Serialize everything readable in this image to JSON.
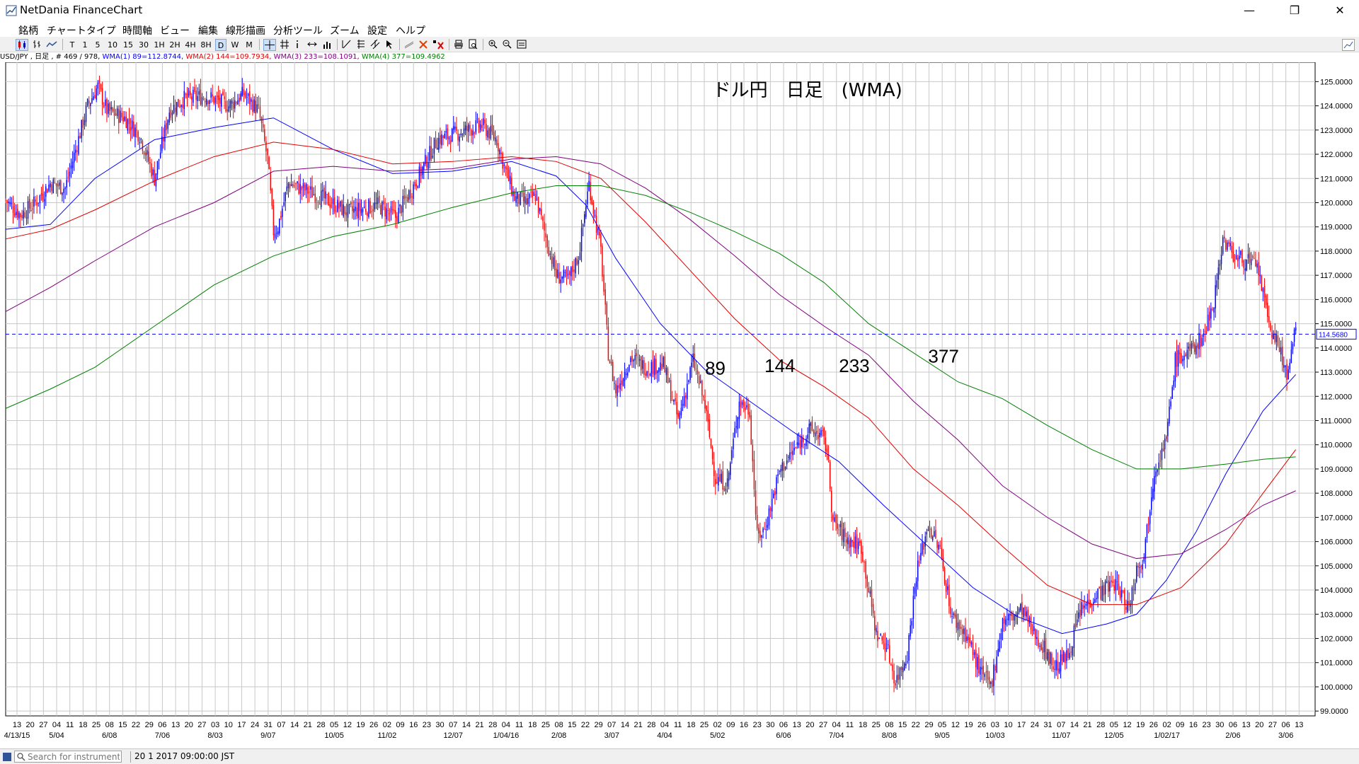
{
  "window": {
    "title": "NetDania FinanceChart",
    "minimize_glyph": "—",
    "restore_glyph": "❐",
    "close_glyph": "✕"
  },
  "menu": [
    "銘柄",
    "チャートタイプ",
    "時間軸",
    "ビュー",
    "編集",
    "線形描画",
    "分析ツール",
    "ズーム",
    "設定",
    "ヘルプ"
  ],
  "toolbar": {
    "timeframes": [
      "T",
      "1",
      "5",
      "10",
      "15",
      "30",
      "1H",
      "2H",
      "4H",
      "8H",
      "D",
      "W",
      "M"
    ],
    "active_timeframe": "D",
    "tools": [
      "crosshair-icon",
      "grid-icon",
      "info-icon",
      "arrows-icon",
      "volume-icon",
      "line-tool-icon",
      "fib-icon",
      "parallel-icon",
      "cursor-icon",
      "trendline-icon",
      "delete-icon",
      "clear-icon",
      "print-icon",
      "print-preview-icon",
      "zoom-in-icon",
      "zoom-out-icon",
      "zoom-fit-icon"
    ]
  },
  "legend": {
    "symbol": "USD/JPY , 日足 , # 469 / 978,",
    "wma1": "WMA(1) 89=112.8744,",
    "wma2": "WMA(2) 144=109.7934,",
    "wma3": "WMA(3) 233=108.1091,",
    "wma4": "WMA(4) 377=109.4962"
  },
  "colors": {
    "up": "#0000ff",
    "down": "#ff0000",
    "wma89": "#0000ff",
    "wma144": "#e00000",
    "wma233": "#800080",
    "wma377": "#008000",
    "grid": "#c8c8c8",
    "current_line": "#0000ff"
  },
  "status": {
    "search_placeholder": "Search for instrument",
    "time": "20 1 2017 09:00:00 JST"
  },
  "chart_data": {
    "type": "candlestick",
    "symbol": "USD/JPY",
    "title": "ドル円　日足　(WMA)",
    "current_price": "114.5680",
    "ylim": [
      98.8,
      125.8
    ],
    "y_ticks": [
      "125.0000",
      "124.0000",
      "123.0000",
      "122.0000",
      "121.0000",
      "120.0000",
      "119.0000",
      "118.0000",
      "117.0000",
      "116.0000",
      "115.0000",
      "114.0000",
      "113.0000",
      "112.0000",
      "111.0000",
      "110.0000",
      "109.0000",
      "108.0000",
      "107.0000",
      "106.0000",
      "105.0000",
      "104.0000",
      "103.0000",
      "102.0000",
      "101.0000",
      "100.0000",
      "99.0000"
    ],
    "x_ticks": [
      "13",
      "20",
      "27",
      "04",
      "11",
      "18",
      "25",
      "08",
      "15",
      "22",
      "29",
      "06",
      "13",
      "20",
      "27",
      "03",
      "10",
      "17",
      "24",
      "31",
      "07",
      "14",
      "21",
      "28",
      "05",
      "12",
      "19",
      "26",
      "02",
      "09",
      "16",
      "23",
      "30",
      "07",
      "14",
      "21",
      "28",
      "04",
      "11",
      "18",
      "25",
      "08",
      "15",
      "22",
      "29",
      "07",
      "14",
      "21",
      "28",
      "04",
      "11",
      "18",
      "25",
      "02",
      "09",
      "16",
      "23",
      "30",
      "06",
      "13",
      "20",
      "27",
      "04",
      "11",
      "18",
      "25",
      "08",
      "15",
      "22",
      "29",
      "05",
      "12",
      "19",
      "26",
      "03",
      "10",
      "17",
      "24",
      "31",
      "07",
      "14",
      "21",
      "28",
      "05",
      "12",
      "19",
      "26",
      "02",
      "09",
      "16",
      "23",
      "30",
      "06",
      "13",
      "20",
      "27",
      "06",
      "13"
    ],
    "x_month_labels": [
      {
        "label": "4/13/15",
        "at": "13"
      },
      {
        "label": "5/04",
        "at": "04"
      },
      {
        "label": "6/08",
        "at": "08"
      },
      {
        "label": "7/06",
        "at": "06"
      },
      {
        "label": "8/03",
        "at": "03"
      },
      {
        "label": "9/07",
        "at": "31"
      },
      {
        "label": "10/05",
        "at": "05"
      },
      {
        "label": "11/02",
        "at": "02"
      },
      {
        "label": "12/07",
        "at": "07"
      },
      {
        "label": "1/04/16",
        "at": "04"
      },
      {
        "label": "2/08",
        "at": "08"
      },
      {
        "label": "3/07",
        "at": "07"
      },
      {
        "label": "4/04",
        "at": "04"
      },
      {
        "label": "5/02",
        "at": "02"
      },
      {
        "label": "6/06",
        "at": "06"
      },
      {
        "label": "7/04",
        "at": "04"
      },
      {
        "label": "8/08",
        "at": "08"
      },
      {
        "label": "9/05",
        "at": "05"
      },
      {
        "label": "10/03",
        "at": "03"
      },
      {
        "label": "11/07",
        "at": "07"
      },
      {
        "label": "12/05",
        "at": "05"
      },
      {
        "label": "1/02/17",
        "at": "02"
      },
      {
        "label": "2/06",
        "at": "06"
      },
      {
        "label": "3/06",
        "at": "06"
      }
    ],
    "close_path": [
      [
        0,
        120.1
      ],
      [
        10,
        119.5
      ],
      [
        20,
        120.0
      ],
      [
        30,
        120.8
      ],
      [
        40,
        120.6
      ],
      [
        55,
        124.0
      ],
      [
        62,
        124.8
      ],
      [
        68,
        123.8
      ],
      [
        80,
        123.5
      ],
      [
        90,
        122.8
      ],
      [
        100,
        121.0
      ],
      [
        110,
        123.8
      ],
      [
        120,
        124.3
      ],
      [
        135,
        124.4
      ],
      [
        150,
        124.0
      ],
      [
        160,
        124.5
      ],
      [
        170,
        123.8
      ],
      [
        176,
        121.8
      ],
      [
        180,
        118.8
      ],
      [
        183,
        119.0
      ],
      [
        190,
        120.8
      ],
      [
        210,
        120.3
      ],
      [
        230,
        119.6
      ],
      [
        250,
        119.9
      ],
      [
        262,
        119.4
      ],
      [
        275,
        120.8
      ],
      [
        290,
        122.6
      ],
      [
        300,
        122.8
      ],
      [
        320,
        123.2
      ],
      [
        330,
        122.6
      ],
      [
        335,
        121.5
      ],
      [
        342,
        120.2
      ],
      [
        350,
        120.0
      ],
      [
        356,
        120.3
      ],
      [
        362,
        118.8
      ],
      [
        370,
        117.0
      ],
      [
        378,
        116.8
      ],
      [
        385,
        117.8
      ],
      [
        392,
        120.8
      ],
      [
        400,
        118.0
      ],
      [
        405,
        113.8
      ],
      [
        410,
        112.2
      ],
      [
        420,
        113.6
      ],
      [
        430,
        113.2
      ],
      [
        442,
        113.3
      ],
      [
        452,
        111.0
      ],
      [
        462,
        113.5
      ],
      [
        470,
        111.6
      ],
      [
        477,
        108.6
      ],
      [
        485,
        108.4
      ],
      [
        493,
        111.8
      ],
      [
        500,
        111.4
      ],
      [
        505,
        106.2
      ],
      [
        510,
        106.5
      ],
      [
        520,
        108.9
      ],
      [
        530,
        109.8
      ],
      [
        540,
        110.6
      ],
      [
        548,
        110.4
      ],
      [
        552,
        109.8
      ],
      [
        556,
        106.8
      ],
      [
        565,
        106.1
      ],
      [
        575,
        105.8
      ],
      [
        585,
        102.2
      ],
      [
        592,
        101.7
      ],
      [
        598,
        100.2
      ],
      [
        606,
        101.4
      ],
      [
        612,
        104.7
      ],
      [
        620,
        106.7
      ],
      [
        628,
        105.6
      ],
      [
        636,
        102.9
      ],
      [
        646,
        102.1
      ],
      [
        655,
        100.6
      ],
      [
        662,
        100.0
      ],
      [
        670,
        102.7
      ],
      [
        677,
        102.9
      ],
      [
        683,
        103.2
      ],
      [
        690,
        102.3
      ],
      [
        697,
        101.7
      ],
      [
        705,
        100.8
      ],
      [
        714,
        101.3
      ],
      [
        722,
        103.1
      ],
      [
        732,
        103.8
      ],
      [
        745,
        104.3
      ],
      [
        755,
        103.3
      ],
      [
        760,
        104.9
      ],
      [
        765,
        105.5
      ],
      [
        772,
        109.0
      ],
      [
        780,
        110.2
      ],
      [
        786,
        113.5
      ],
      [
        795,
        113.8
      ],
      [
        805,
        114.5
      ],
      [
        812,
        116.0
      ],
      [
        818,
        118.5
      ],
      [
        827,
        117.7
      ],
      [
        835,
        117.6
      ],
      [
        842,
        117.2
      ],
      [
        848,
        115.2
      ],
      [
        856,
        113.9
      ],
      [
        862,
        112.8
      ],
      [
        867,
        114.9
      ]
    ],
    "series": [
      {
        "name": "89",
        "points": [
          [
            0,
            118.9
          ],
          [
            30,
            119.1
          ],
          [
            60,
            121.0
          ],
          [
            100,
            122.6
          ],
          [
            140,
            123.1
          ],
          [
            180,
            123.5
          ],
          [
            220,
            122.2
          ],
          [
            260,
            121.2
          ],
          [
            300,
            121.3
          ],
          [
            340,
            121.7
          ],
          [
            370,
            121.1
          ],
          [
            390,
            119.9
          ],
          [
            410,
            117.7
          ],
          [
            440,
            115.0
          ],
          [
            470,
            113.1
          ],
          [
            500,
            111.8
          ],
          [
            530,
            110.5
          ],
          [
            560,
            109.3
          ],
          [
            590,
            107.5
          ],
          [
            620,
            105.8
          ],
          [
            650,
            104.1
          ],
          [
            680,
            102.9
          ],
          [
            710,
            102.2
          ],
          [
            740,
            102.6
          ],
          [
            760,
            103.0
          ],
          [
            780,
            104.4
          ],
          [
            800,
            106.4
          ],
          [
            820,
            108.8
          ],
          [
            845,
            111.4
          ],
          [
            867,
            112.9
          ]
        ]
      },
      {
        "name": "144",
        "points": [
          [
            0,
            118.5
          ],
          [
            30,
            118.9
          ],
          [
            60,
            119.7
          ],
          [
            100,
            120.9
          ],
          [
            140,
            121.9
          ],
          [
            180,
            122.5
          ],
          [
            220,
            122.2
          ],
          [
            260,
            121.6
          ],
          [
            300,
            121.7
          ],
          [
            340,
            121.9
          ],
          [
            370,
            121.7
          ],
          [
            400,
            121.0
          ],
          [
            430,
            119.2
          ],
          [
            460,
            117.2
          ],
          [
            490,
            115.2
          ],
          [
            520,
            113.5
          ],
          [
            550,
            112.4
          ],
          [
            580,
            111.1
          ],
          [
            610,
            109.0
          ],
          [
            640,
            107.5
          ],
          [
            670,
            105.8
          ],
          [
            700,
            104.2
          ],
          [
            730,
            103.4
          ],
          [
            760,
            103.4
          ],
          [
            790,
            104.1
          ],
          [
            820,
            105.9
          ],
          [
            845,
            108.0
          ],
          [
            867,
            109.8
          ]
        ]
      },
      {
        "name": "233",
        "points": [
          [
            0,
            115.5
          ],
          [
            30,
            116.5
          ],
          [
            60,
            117.6
          ],
          [
            100,
            119.0
          ],
          [
            140,
            120.0
          ],
          [
            180,
            121.3
          ],
          [
            220,
            121.5
          ],
          [
            260,
            121.3
          ],
          [
            300,
            121.4
          ],
          [
            340,
            121.8
          ],
          [
            370,
            121.9
          ],
          [
            400,
            121.6
          ],
          [
            430,
            120.6
          ],
          [
            460,
            119.3
          ],
          [
            490,
            117.8
          ],
          [
            520,
            116.2
          ],
          [
            550,
            114.9
          ],
          [
            580,
            113.7
          ],
          [
            610,
            111.8
          ],
          [
            640,
            110.2
          ],
          [
            670,
            108.3
          ],
          [
            700,
            107.0
          ],
          [
            730,
            105.9
          ],
          [
            760,
            105.3
          ],
          [
            790,
            105.5
          ],
          [
            820,
            106.5
          ],
          [
            845,
            107.5
          ],
          [
            867,
            108.1
          ]
        ]
      },
      {
        "name": "377",
        "points": [
          [
            0,
            111.5
          ],
          [
            30,
            112.3
          ],
          [
            60,
            113.2
          ],
          [
            100,
            114.9
          ],
          [
            140,
            116.6
          ],
          [
            180,
            117.8
          ],
          [
            220,
            118.6
          ],
          [
            260,
            119.1
          ],
          [
            300,
            119.8
          ],
          [
            340,
            120.4
          ],
          [
            370,
            120.7
          ],
          [
            400,
            120.7
          ],
          [
            430,
            120.3
          ],
          [
            460,
            119.6
          ],
          [
            490,
            118.8
          ],
          [
            520,
            117.9
          ],
          [
            550,
            116.7
          ],
          [
            580,
            115.0
          ],
          [
            610,
            113.8
          ],
          [
            640,
            112.6
          ],
          [
            670,
            111.9
          ],
          [
            700,
            110.8
          ],
          [
            730,
            109.8
          ],
          [
            760,
            109.0
          ],
          [
            790,
            109.0
          ],
          [
            820,
            109.2
          ],
          [
            845,
            109.4
          ],
          [
            867,
            109.5
          ]
        ]
      }
    ],
    "annotations": [
      {
        "text": "89",
        "at": [
          470,
          112.9
        ]
      },
      {
        "text": "144",
        "at": [
          510,
          113.0
        ]
      },
      {
        "text": "233",
        "at": [
          560,
          113.0
        ]
      },
      {
        "text": "377",
        "at": [
          620,
          113.4
        ]
      }
    ],
    "grid": true
  }
}
